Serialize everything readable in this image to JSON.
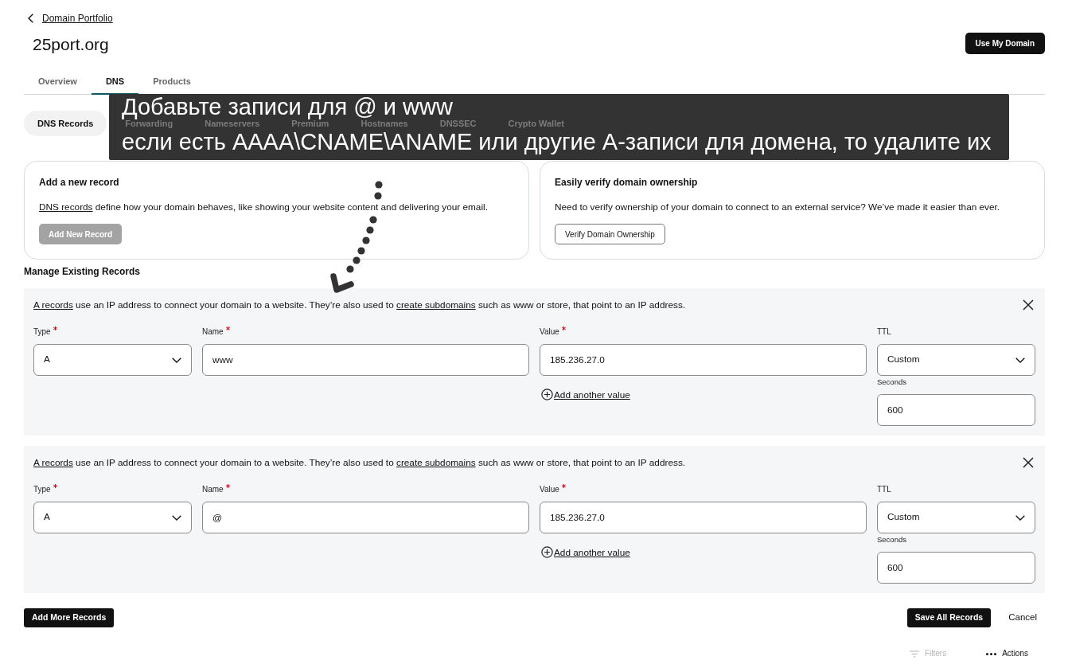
{
  "back_link": {
    "label": "Domain Portfolio"
  },
  "domain": {
    "title": "25port.org",
    "action": "Use My Domain"
  },
  "tabs": [
    {
      "label": "Overview",
      "selected": false
    },
    {
      "label": "DNS",
      "selected": true
    },
    {
      "label": "Products",
      "selected": false
    }
  ],
  "dns_tabs": [
    {
      "label": "DNS Records",
      "selected": true
    },
    {
      "label": "Forwarding",
      "selected": false
    },
    {
      "label": "Nameservers",
      "selected": false
    },
    {
      "label": "Premium",
      "selected": false
    },
    {
      "label": "Hostnames",
      "selected": false
    },
    {
      "label": "DNSSEC",
      "selected": false
    },
    {
      "label": "Crypto Wallet",
      "selected": false
    }
  ],
  "annotation": {
    "lines": [
      "Добавьте записи для @ и www",
      "если есть AAAA\\CNAME\\ANAME или другие А-записи для домена, то удалите их"
    ]
  },
  "cards": [
    {
      "title": "Add a new record",
      "text": [
        {
          "kind": "link",
          "text": "DNS records"
        },
        {
          "kind": "text",
          "text": " define how your domain behaves, like showing your website content and delivering your email."
        }
      ],
      "button": {
        "label": "Add New Record",
        "kind": "solid",
        "disabled": true
      }
    },
    {
      "title": "Easily verify domain ownership",
      "text": [
        {
          "kind": "text",
          "text": "Need to verify ownership of your domain to connect to an external service? We’ve made it easier than ever."
        }
      ],
      "button": {
        "label": "Verify Domain Ownership",
        "kind": "outline",
        "disabled": false
      }
    }
  ],
  "section_title": "Manage Existing Records",
  "records": [
    {
      "description": [
        {
          "kind": "link",
          "text": "A records"
        },
        {
          "kind": "text",
          "text": " use an IP address to connect your domain to a website. They’re also used to "
        },
        {
          "kind": "link",
          "text": "create subdomains"
        },
        {
          "kind": "text",
          "text": " such as www or store, that point to an IP address."
        }
      ],
      "fields": [
        {
          "label": "Type",
          "required": true,
          "kind": "select",
          "value": "A"
        },
        {
          "label": "Name",
          "required": true,
          "kind": "input",
          "value": "www"
        },
        {
          "label": "Value",
          "required": true,
          "kind": "input",
          "value": "185.236.27.0",
          "add_link": "Add another value"
        },
        {
          "label": "TTL",
          "required": false,
          "kind": "select",
          "value": "Custom",
          "sub_field": {
            "label": "Seconds",
            "value": "600"
          }
        }
      ]
    },
    {
      "description": [
        {
          "kind": "link",
          "text": "A records"
        },
        {
          "kind": "text",
          "text": " use an IP address to connect your domain to a website. They’re also used to "
        },
        {
          "kind": "link",
          "text": "create subdomains"
        },
        {
          "kind": "text",
          "text": " such as www or store, that point to an IP address."
        }
      ],
      "fields": [
        {
          "label": "Type",
          "required": true,
          "kind": "select",
          "value": "A"
        },
        {
          "label": "Name",
          "required": true,
          "kind": "input",
          "value": "@"
        },
        {
          "label": "Value",
          "required": true,
          "kind": "input",
          "value": "185.236.27.0",
          "add_link": "Add another value"
        },
        {
          "label": "TTL",
          "required": false,
          "kind": "select",
          "value": "Custom",
          "sub_field": {
            "label": "Seconds",
            "value": "600"
          }
        }
      ]
    }
  ],
  "footer": {
    "add_more": "Add More Records",
    "save": "Save All Records",
    "cancel": "Cancel"
  },
  "toolbar": [
    {
      "label": "Filters",
      "kind": "filter",
      "disabled": true
    },
    {
      "label": "Actions",
      "kind": "more",
      "disabled": false
    }
  ]
}
